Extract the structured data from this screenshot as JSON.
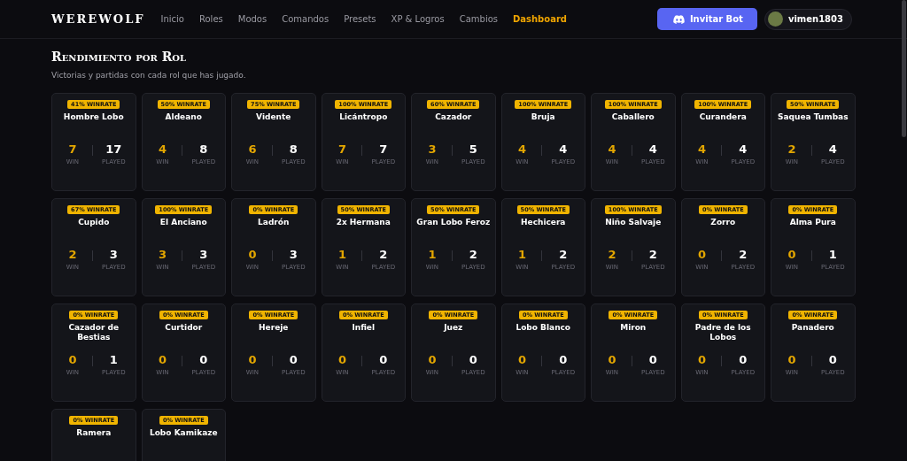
{
  "brand": "WEREWOLF",
  "nav": [
    {
      "label": "Inicio",
      "selected": false
    },
    {
      "label": "Roles",
      "selected": false
    },
    {
      "label": "Modos",
      "selected": false
    },
    {
      "label": "Comandos",
      "selected": false
    },
    {
      "label": "Presets",
      "selected": false
    },
    {
      "label": "XP & Logros",
      "selected": false
    },
    {
      "label": "Cambios",
      "selected": false
    },
    {
      "label": "Dashboard",
      "selected": true
    }
  ],
  "invite_button": "Invitar Bot",
  "user": {
    "name": "vimen1803"
  },
  "section": {
    "title": "Rendimiento por Rol",
    "subtitle": "Victorias y partidas con cada rol que has jugado."
  },
  "roles": [
    {
      "badge": "41% WINRATE",
      "name": "Hombre Lobo",
      "win": "7",
      "win_label": "WIN",
      "played": "17",
      "played_label": "PLAYED"
    },
    {
      "badge": "50% WINRATE",
      "name": "Aldeano",
      "win": "4",
      "win_label": "WIN",
      "played": "8",
      "played_label": "PLAYED"
    },
    {
      "badge": "75% WINRATE",
      "name": "Vidente",
      "win": "6",
      "win_label": "WIN",
      "played": "8",
      "played_label": "PLAYED"
    },
    {
      "badge": "100% WINRATE",
      "name": "Licántropo",
      "win": "7",
      "win_label": "WIN",
      "played": "7",
      "played_label": "PLAYED"
    },
    {
      "badge": "60% WINRATE",
      "name": "Cazador",
      "win": "3",
      "win_label": "WIN",
      "played": "5",
      "played_label": "PLAYED"
    },
    {
      "badge": "100% WINRATE",
      "name": "Bruja",
      "win": "4",
      "win_label": "WIN",
      "played": "4",
      "played_label": "PLAYED"
    },
    {
      "badge": "100% WINRATE",
      "name": "Caballero",
      "win": "4",
      "win_label": "WIN",
      "played": "4",
      "played_label": "PLAYED"
    },
    {
      "badge": "100% WINRATE",
      "name": "Curandera",
      "win": "4",
      "win_label": "WIN",
      "played": "4",
      "played_label": "PLAYED"
    },
    {
      "badge": "50% WINRATE",
      "name": "Saquea Tumbas",
      "win": "2",
      "win_label": "WIN",
      "played": "4",
      "played_label": "PLAYED"
    },
    {
      "badge": "67% WINRATE",
      "name": "Cupido",
      "win": "2",
      "win_label": "WIN",
      "played": "3",
      "played_label": "PLAYED"
    },
    {
      "badge": "100% WINRATE",
      "name": "El Anciano",
      "win": "3",
      "win_label": "WIN",
      "played": "3",
      "played_label": "PLAYED"
    },
    {
      "badge": "0% WINRATE",
      "name": "Ladrón",
      "win": "0",
      "win_label": "WIN",
      "played": "3",
      "played_label": "PLAYED"
    },
    {
      "badge": "50% WINRATE",
      "name": "2x Hermana",
      "win": "1",
      "win_label": "WIN",
      "played": "2",
      "played_label": "PLAYED"
    },
    {
      "badge": "50% WINRATE",
      "name": "Gran Lobo Feroz",
      "win": "1",
      "win_label": "WIN",
      "played": "2",
      "played_label": "PLAYED"
    },
    {
      "badge": "50% WINRATE",
      "name": "Hechicera",
      "win": "1",
      "win_label": "WIN",
      "played": "2",
      "played_label": "PLAYED"
    },
    {
      "badge": "100% WINRATE",
      "name": "Niño Salvaje",
      "win": "2",
      "win_label": "WIN",
      "played": "2",
      "played_label": "PLAYED"
    },
    {
      "badge": "0% WINRATE",
      "name": "Zorro",
      "win": "0",
      "win_label": "WIN",
      "played": "2",
      "played_label": "PLAYED"
    },
    {
      "badge": "0% WINRATE",
      "name": "Alma Pura",
      "win": "0",
      "win_label": "WIN",
      "played": "1",
      "played_label": "PLAYED"
    },
    {
      "badge": "0% WINRATE",
      "name": "Cazador de Bestias",
      "win": "0",
      "win_label": "WIN",
      "played": "1",
      "played_label": "PLAYED"
    },
    {
      "badge": "0% WINRATE",
      "name": "Curtidor",
      "win": "0",
      "win_label": "WIN",
      "played": "0",
      "played_label": "PLAYED"
    },
    {
      "badge": "0% WINRATE",
      "name": "Hereje",
      "win": "0",
      "win_label": "WIN",
      "played": "0",
      "played_label": "PLAYED"
    },
    {
      "badge": "0% WINRATE",
      "name": "Infiel",
      "win": "0",
      "win_label": "WIN",
      "played": "0",
      "played_label": "PLAYED"
    },
    {
      "badge": "0% WINRATE",
      "name": "Juez",
      "win": "0",
      "win_label": "WIN",
      "played": "0",
      "played_label": "PLAYED"
    },
    {
      "badge": "0% WINRATE",
      "name": "Lobo Blanco",
      "win": "0",
      "win_label": "WIN",
      "played": "0",
      "played_label": "PLAYED"
    },
    {
      "badge": "0% WINRATE",
      "name": "Miron",
      "win": "0",
      "win_label": "WIN",
      "played": "0",
      "played_label": "PLAYED"
    },
    {
      "badge": "0% WINRATE",
      "name": "Padre de los Lobos",
      "win": "0",
      "win_label": "WIN",
      "played": "0",
      "played_label": "PLAYED"
    },
    {
      "badge": "0% WINRATE",
      "name": "Panadero",
      "win": "0",
      "win_label": "WIN",
      "played": "0",
      "played_label": "PLAYED"
    },
    {
      "badge": "0% WINRATE",
      "name": "Ramera"
    },
    {
      "badge": "0% WINRATE",
      "name": "Lobo Kamikaze"
    }
  ]
}
